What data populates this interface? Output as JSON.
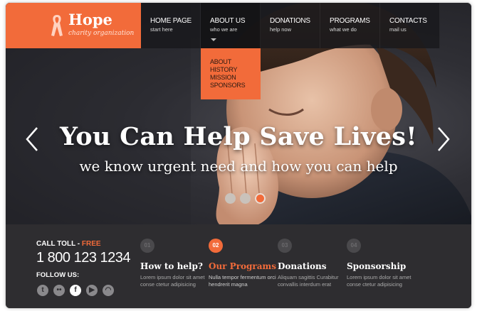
{
  "logo": {
    "name": "Hope",
    "tagline": "charity organization"
  },
  "nav": {
    "items": [
      {
        "label": "HOME PAGE",
        "sub": "start here"
      },
      {
        "label": "ABOUT US",
        "sub": "who we are"
      },
      {
        "label": "DONATIONS",
        "sub": "help now"
      },
      {
        "label": "PROGRAMS",
        "sub": "what we do"
      },
      {
        "label": "CONTACTS",
        "sub": "mail us"
      }
    ],
    "dropdown": [
      "ABOUT",
      "HISTORY",
      "MISSION",
      "SPONSORS"
    ]
  },
  "slider": {
    "title": "You Can Help Save Lives!",
    "subtitle": "we know urgent need and how you can help",
    "slide_count": 3,
    "active_slide": 3
  },
  "contact": {
    "call_label": "CALL TOLL - ",
    "call_accent": "FREE",
    "phone": "1 800 123 1234",
    "follow_label": "FOLLOW US:",
    "socials": [
      "twitter-icon",
      "flickr-icon",
      "facebook-icon",
      "youtube-icon",
      "rss-icon"
    ]
  },
  "features": [
    {
      "num": "01",
      "title": "How to help?",
      "text": "Lorem ipsum dolor sit amet conse ctetur adipisicing"
    },
    {
      "num": "02",
      "title": "Our Programs",
      "text": "Nulla tempor fermentum orci hendrerit magna"
    },
    {
      "num": "03",
      "title": "Donations",
      "text": "Aliquam sagittis Curabitur convallis interdum erat"
    },
    {
      "num": "04",
      "title": "Sponsorship",
      "text": "Lorem ipsum dolor sit amet conse ctetur adipisicing"
    }
  ],
  "colors": {
    "accent": "#f26b3a",
    "nav_bg": "#1a1a1d",
    "footer_bg": "#2e2d30"
  }
}
